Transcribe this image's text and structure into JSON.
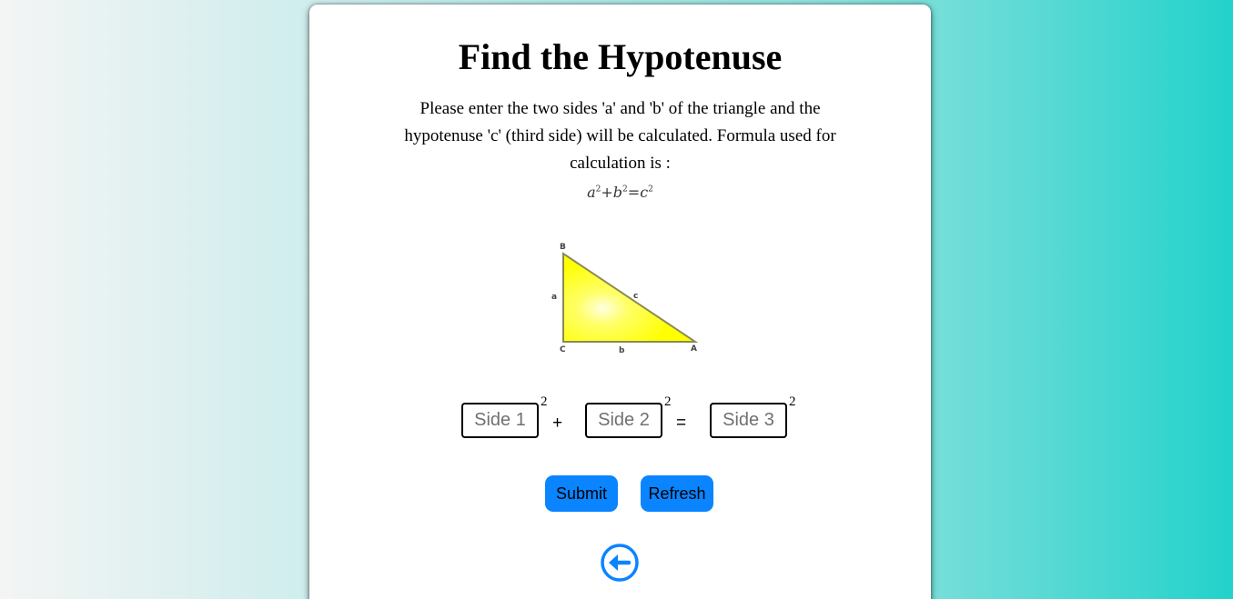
{
  "page": {
    "title": "Find the Hypotenuse",
    "description": "Please enter the two sides 'a' and 'b' of the triangle and the hypotenuse 'c' (third side) will be calculated. Formula used for calculation is :"
  },
  "formula": {
    "a": "a",
    "b": "b",
    "c": "c",
    "exp": "2",
    "plus": "+",
    "equals": "="
  },
  "triangle": {
    "vertex_b": "B",
    "vertex_c": "C",
    "vertex_a": "A",
    "side_a": "a",
    "side_b": "b",
    "side_c": "c",
    "fill_color": "#ffff00"
  },
  "inputs": {
    "side1": {
      "value": "",
      "placeholder": "Side 1",
      "exponent": "2"
    },
    "side2": {
      "value": "",
      "placeholder": "Side 2",
      "exponent": "2"
    },
    "side3": {
      "value": "",
      "placeholder": "Side 3",
      "exponent": "2"
    },
    "plus": "+",
    "equals": "="
  },
  "buttons": {
    "submit": "Submit",
    "refresh": "Refresh"
  },
  "back": {
    "icon": "arrow-left-circle-icon",
    "color": "#0a84ff"
  },
  "colors": {
    "accent": "#0a84ff",
    "background_start": "#f4f4f4",
    "background_end": "#22d2cb"
  }
}
